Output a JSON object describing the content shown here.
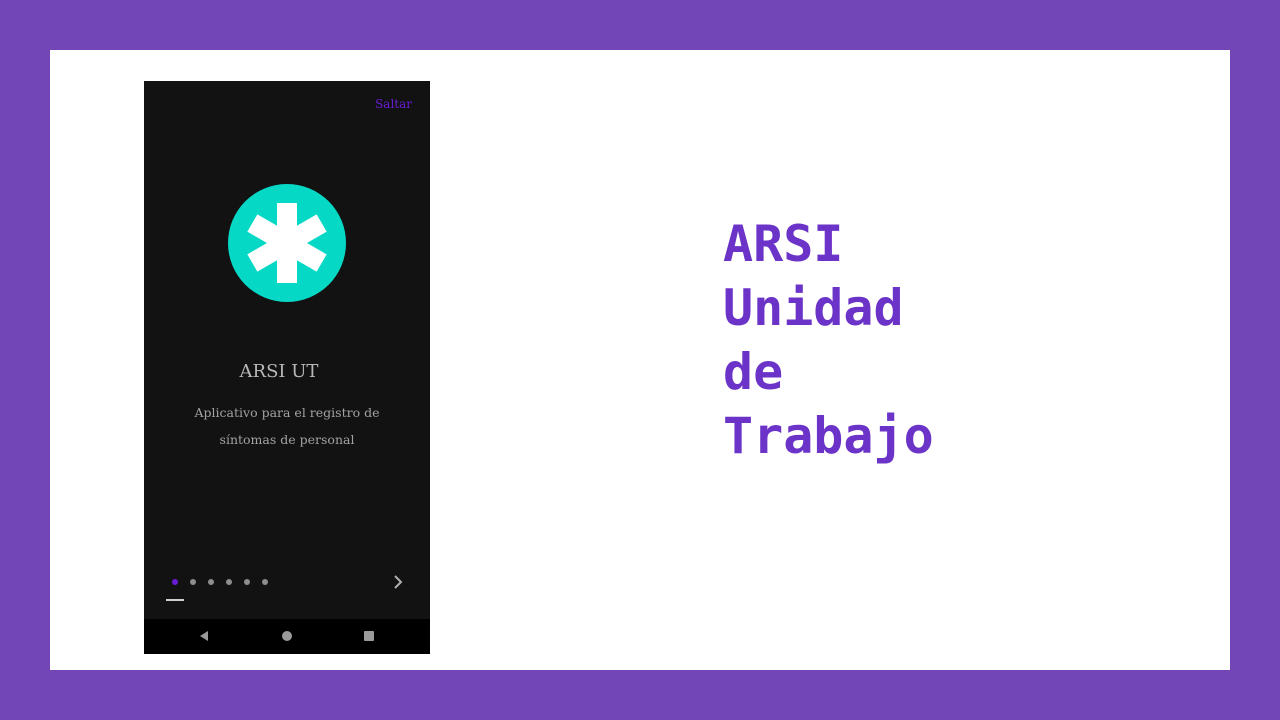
{
  "colors": {
    "frame": "#7346b7",
    "card": "#ffffff",
    "phone_bg": "#121212",
    "accent_purple": "#6a1bd6",
    "logo_teal": "#06d8c6",
    "headline": "#6b33c7"
  },
  "phone": {
    "skip_label": "Saltar",
    "logo_icon": "medical-asterisk-icon",
    "app_title": "ARSI UT",
    "app_description": "Aplicativo para el registro de síntomas de personal",
    "pager": {
      "total": 6,
      "active_index": 0
    },
    "next_icon": "chevron-right-icon",
    "nav_icons": [
      "back-triangle-icon",
      "home-circle-icon",
      "recent-square-icon"
    ]
  },
  "headline": {
    "lines": [
      "ARSI",
      "Unidad",
      "de",
      "Trabajo"
    ]
  }
}
